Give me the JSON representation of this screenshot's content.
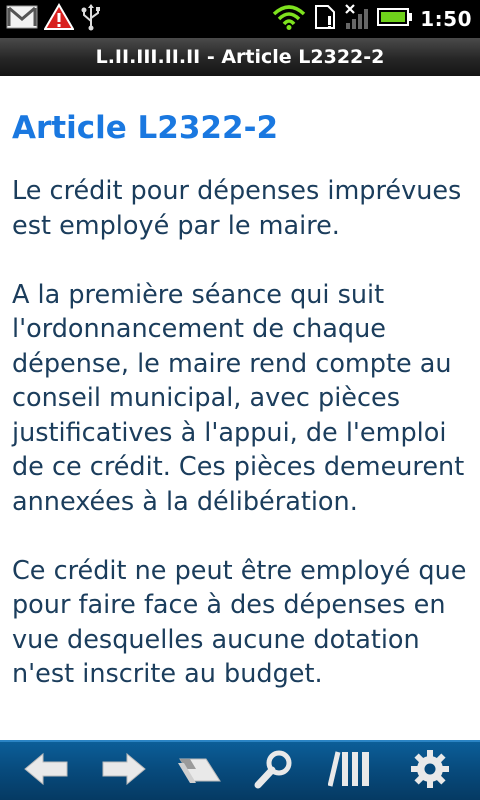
{
  "status_bar": {
    "time": "1:50",
    "icons": [
      "gmail-icon",
      "warning-icon",
      "usb-icon",
      "wifi-icon",
      "sim-icon",
      "no-signal-icon",
      "battery-icon"
    ]
  },
  "title_bar": {
    "title": "L.II.III.II.II - Article L2322-2"
  },
  "article": {
    "heading": "Article L2322-2",
    "paragraphs": [
      "Le crédit pour dépenses imprévues est employé par le maire.",
      "A la première séance qui suit l'ordonnancement de chaque dépense, le maire rend compte au conseil municipal, avec pièces justificatives à l'appui, de l'emploi de ce crédit. Ces pièces demeurent annexées à la délibération.",
      "Ce crédit ne peut être employé que pour faire face à des dépenses en vue desquelles aucune dotation n'est inscrite au budget."
    ]
  },
  "toolbar": {
    "buttons": [
      "back-arrow-icon",
      "forward-arrow-icon",
      "toc-icon",
      "search-icon",
      "library-icon",
      "settings-gear-icon"
    ]
  },
  "colors": {
    "heading": "#1a78e0",
    "body_text": "#1b3d5c",
    "toolbar": "#074a7c"
  }
}
